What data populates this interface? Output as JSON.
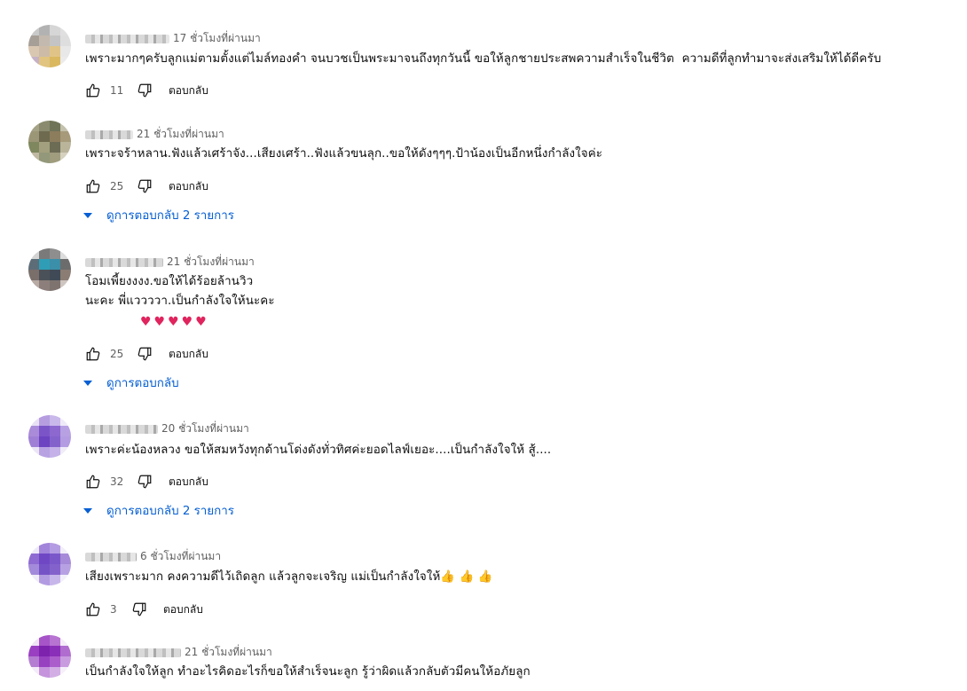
{
  "reply_label": "ตอบกลับ",
  "comments": [
    {
      "time": "17 ชั่วโมงที่ผ่านมา",
      "lines": [
        "เพราะมากๆครับลูกแม่ตามตั้งแต่ไมล์ทองคำ จนบวชเป็นพระมาจนถึงทุกวันนี้ ขอให้ลูกชายประสพความสำเร็จในชีวิต  ความดีที่ลูกทำมาจะส่งเสริมให้ได้ดีครับ"
      ],
      "likes": "11",
      "colors": [
        "#c9c9c9",
        "#b2b2b2",
        "#d6d6d6",
        "#e0e0e0",
        "#a69f98",
        "#c4b9ae",
        "#c4c4c4",
        "#dedede",
        "#d9c7b1",
        "#cdbba8",
        "#e0c487",
        "#e8e8e8",
        "#c6b2c6",
        "#e1c47f",
        "#d9b85f",
        "#ebebeb"
      ]
    },
    {
      "time": "21 ชั่วโมงที่ผ่านมา",
      "lines": [
        "เพราะจร้าหลาน.ฟังแล้วเศร้าจัง...เสียงเศร้า..ฟังแล้วขนลุก..ขอให้ดังๆๆๆ.ป้าน้องเป็นอีกหนึ่งกำลังใจค่ะ"
      ],
      "likes": "25",
      "replies": "ดูการตอบกลับ 2 รายการ",
      "colors": [
        "#a5a285",
        "#8a8a6e",
        "#6f7458",
        "#c3c1ac",
        "#9b9676",
        "#6d6a4f",
        "#8c7d5d",
        "#a69a7a",
        "#7e875d",
        "#a2a07e",
        "#6c6c55",
        "#b9b49a",
        "#c0b9a1",
        "#93987a",
        "#9f9d7d",
        "#d6d1bf"
      ]
    },
    {
      "time": "21 ชั่วโมงที่ผ่านมา",
      "lines": [
        "โอมเพี้ยงงงง.ขอให้ได้ร้อยล้านวิว",
        "นะคะ พี่แววววา.เป็นกำลังใจให้นะคะ"
      ],
      "hearts": "♥♥♥♥♥",
      "likes": "25",
      "replies": "ดูการตอบกลับ",
      "colors": [
        "#d4d4d4",
        "#7a7a7a",
        "#8e8e8e",
        "#dcdcdc",
        "#5d6d78",
        "#2f9db5",
        "#3b8fa8",
        "#6c6c6c",
        "#7a6f6a",
        "#4b5158",
        "#3f4a56",
        "#8b7d74",
        "#b8aaa4",
        "#8c7f7b",
        "#7f7370",
        "#cfc5c0"
      ]
    },
    {
      "time": "20 ชั่วโมงที่ผ่านมา",
      "lines": [
        "เพราะค่ะน้องหลวง ขอให้สมหวังทุกด้านโด่งดังทั่วทิศค่ะยอดไลฟ์เยอะ....เป็นกำลังใจให้ สู้...."
      ],
      "likes": "32",
      "replies": "ดูการตอบกลับ 2 รายการ",
      "colors": [
        "#e8e1f4",
        "#b69de0",
        "#c9b8ea",
        "#efeaf8",
        "#a98bd9",
        "#7b55c8",
        "#8c68cf",
        "#b7a1e3",
        "#9f7fd6",
        "#6c43c0",
        "#8462cc",
        "#b49ce2",
        "#ebe5f6",
        "#b8a2e2",
        "#c4b2e8",
        "#f0ecf8"
      ]
    },
    {
      "time": "6 ชั่วโมงที่ผ่านมา",
      "lines": [
        "เสียงเพราะมาก คงความดีไว้เถิดลูก แล้วลูกจะเจริญ แม่เป็นกำลังใจให้👍 👍 👍"
      ],
      "likes": "3",
      "colors": [
        "#eee9f8",
        "#a284db",
        "#b49ce2",
        "#f1edf9",
        "#8e6ad2",
        "#6f47c5",
        "#7b58c9",
        "#a68ad9",
        "#a48ada",
        "#7553c6",
        "#8462cc",
        "#b7a1e3",
        "#f0ecf8",
        "#b39be1",
        "#c7b6ea",
        "#f3f0fa"
      ]
    },
    {
      "time": "21 ชั่วโมงที่ผ่านมา",
      "lines": [
        "เป็นกำลังใจให้ลูก ทำอะไรคิดอะไรก็ขอให้สำเร็จนะลูก รู้ว่าผิดแล้วกลับตัวมีคนให้อภัยลูก"
      ],
      "colors": [
        "#efe4f4",
        "#a654c8",
        "#b774d1",
        "#f4ecf8",
        "#9a3fc2",
        "#7c22ad",
        "#8a2fb8",
        "#b06ccf",
        "#b47dd1",
        "#9740c0",
        "#ab5dcb",
        "#c99ce0",
        "#f3ebf7",
        "#c594dc",
        "#d2aee5",
        "#f6f0fa"
      ]
    }
  ]
}
